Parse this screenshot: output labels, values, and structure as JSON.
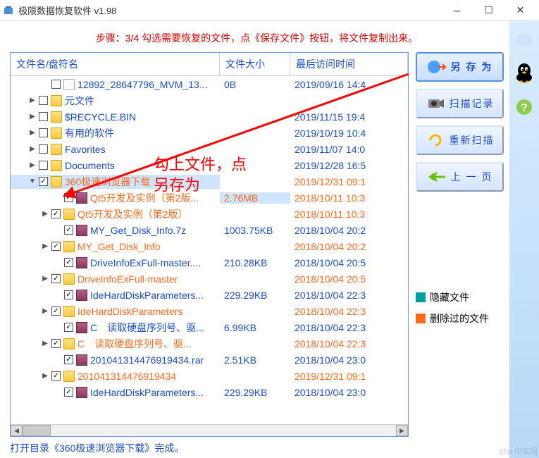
{
  "title": "极限数据恢复软件 v1.98",
  "step_text": "步骤：3/4 勾选需要恢复的文件，点《保存文件》按钮，将文件复制出来。",
  "columns": {
    "name": "文件名/盘符名",
    "size": "文件大小",
    "date": "最后访问时间"
  },
  "buttons": {
    "save_as": "另 存 为",
    "scan_log": "扫描记录",
    "rescan": "重新扫描",
    "prev_page": "上 一 页"
  },
  "legend": {
    "hidden": "隐藏文件",
    "deleted": "删除过的文件"
  },
  "annotation_text": "勾上文件，点另存为",
  "status": "打开目录《360极速浏览器下载》完成。",
  "watermark": "php 中文网",
  "rows": [
    {
      "indent": 42,
      "exp": "",
      "chk": false,
      "icon": "file",
      "color": "blue",
      "name": "12892_28647796_MVM_13...",
      "size": "0B",
      "date": "2019/09/16 14:4"
    },
    {
      "indent": 24,
      "exp": "▶",
      "chk": false,
      "icon": "folder",
      "color": "blue",
      "name": "元文件",
      "size": "",
      "date": ""
    },
    {
      "indent": 24,
      "exp": "▶",
      "chk": false,
      "icon": "folder",
      "color": "blue",
      "name": "$RECYCLE.BIN",
      "size": "",
      "date": "2019/11/15 19:4"
    },
    {
      "indent": 24,
      "exp": "▶",
      "chk": false,
      "icon": "folder",
      "color": "blue",
      "name": "有用的软件",
      "size": "",
      "date": "2019/10/19 10:4"
    },
    {
      "indent": 24,
      "exp": "▶",
      "chk": false,
      "icon": "folder",
      "color": "blue",
      "name": "Favorites",
      "size": "",
      "date": "2019/11/07 14:0"
    },
    {
      "indent": 24,
      "exp": "▶",
      "chk": false,
      "icon": "folder",
      "color": "blue",
      "name": "Documents",
      "size": "",
      "date": "2019/12/28 16:5"
    },
    {
      "indent": 24,
      "exp": "▼",
      "chk": true,
      "icon": "folder",
      "color": "orange",
      "name": "360极速浏览器下载",
      "size": "",
      "date": "2019/12/31 09:1",
      "sel": true
    },
    {
      "indent": 60,
      "exp": "",
      "chk": true,
      "icon": "rar",
      "color": "orange",
      "name": "Qt5开发及实例（第2版...",
      "size": "2.76MB",
      "date": "2018/10/11 10:3",
      "sizesel": true
    },
    {
      "indent": 42,
      "exp": "▶",
      "chk": true,
      "icon": "folder",
      "color": "orange",
      "name": "Qt5开发及实例（第2版）",
      "size": "",
      "date": "2018/10/11 10:3"
    },
    {
      "indent": 60,
      "exp": "",
      "chk": true,
      "icon": "rar",
      "color": "blue",
      "name": "MY_Get_Disk_Info.7z",
      "size": "1003.75KB",
      "date": "2018/10/04 20:2"
    },
    {
      "indent": 42,
      "exp": "▶",
      "chk": true,
      "icon": "folder",
      "color": "orange",
      "name": "MY_Get_Disk_Info",
      "size": "",
      "date": "2018/10/04 20:2"
    },
    {
      "indent": 60,
      "exp": "",
      "chk": true,
      "icon": "rar",
      "color": "blue",
      "name": "DriveInfoExFull-master....",
      "size": "210.28KB",
      "date": "2018/10/04 20:5"
    },
    {
      "indent": 42,
      "exp": "▶",
      "chk": true,
      "icon": "folder",
      "color": "orange",
      "name": "DriveInfoExFull-master",
      "size": "",
      "date": "2018/10/04 20:5"
    },
    {
      "indent": 60,
      "exp": "",
      "chk": true,
      "icon": "rar",
      "color": "blue",
      "name": "IdeHardDiskParameters...",
      "size": "229.29KB",
      "date": "2018/10/04 22:3"
    },
    {
      "indent": 42,
      "exp": "▶",
      "chk": true,
      "icon": "folder",
      "color": "orange",
      "name": "IdeHardDiskParameters",
      "size": "",
      "date": "2018/10/04 22:3"
    },
    {
      "indent": 60,
      "exp": "",
      "chk": true,
      "icon": "rar",
      "color": "blue",
      "name": "C　读取硬盘序列号、驱...",
      "size": "6.99KB",
      "date": "2018/10/04 22:3"
    },
    {
      "indent": 42,
      "exp": "▶",
      "chk": true,
      "icon": "folder",
      "color": "orange",
      "name": "C　读取硬盘序列号、驱...",
      "size": "",
      "date": "2018/10/04 22:3"
    },
    {
      "indent": 60,
      "exp": "",
      "chk": true,
      "icon": "rar",
      "color": "blue",
      "name": "201041314476919434.rar",
      "size": "2.51KB",
      "date": "2018/10/04 23:0"
    },
    {
      "indent": 42,
      "exp": "▶",
      "chk": true,
      "icon": "folder",
      "color": "orange",
      "name": "201041314476919434",
      "size": "",
      "date": "2019/12/31 09:1"
    },
    {
      "indent": 60,
      "exp": "",
      "chk": true,
      "icon": "rar",
      "color": "blue",
      "name": "IdeHardDiskParameters...",
      "size": "229.29KB",
      "date": "2018/10/04 23:0"
    }
  ]
}
